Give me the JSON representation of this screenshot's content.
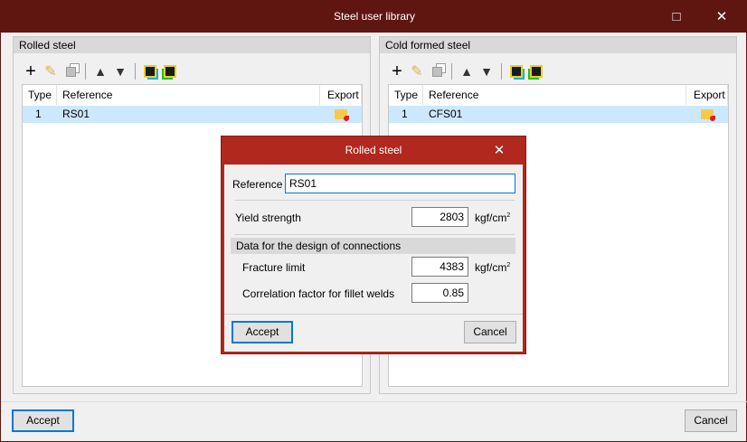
{
  "window": {
    "title": "Steel user library",
    "maximize_icon": "□",
    "close_icon": "✕"
  },
  "panels": [
    {
      "title": "Rolled steel",
      "columns": [
        "Type",
        "Reference",
        "Export"
      ],
      "rows": [
        {
          "type": "1",
          "reference": "RS01"
        }
      ]
    },
    {
      "title": "Cold formed steel",
      "columns": [
        "Type",
        "Reference",
        "Export"
      ],
      "rows": [
        {
          "type": "1",
          "reference": "CFS01"
        }
      ]
    }
  ],
  "toolbar": {
    "add": "+",
    "edit": "✎",
    "up": "▲",
    "down": "▼"
  },
  "footer": {
    "accept": "Accept",
    "cancel": "Cancel"
  },
  "dialog": {
    "title": "Rolled steel",
    "close_icon": "✕",
    "reference_label": "Reference",
    "reference_value": "RS01",
    "yield_label": "Yield strength",
    "yield_value": "2803",
    "unit": "kgf/cm",
    "unit_sup": "2",
    "section": "Data for the design of connections",
    "fracture_label": "Fracture limit",
    "fracture_value": "4383",
    "corr_label": "Correlation factor for fillet welds",
    "corr_value": "0.85",
    "accept": "Accept",
    "cancel": "Cancel"
  }
}
